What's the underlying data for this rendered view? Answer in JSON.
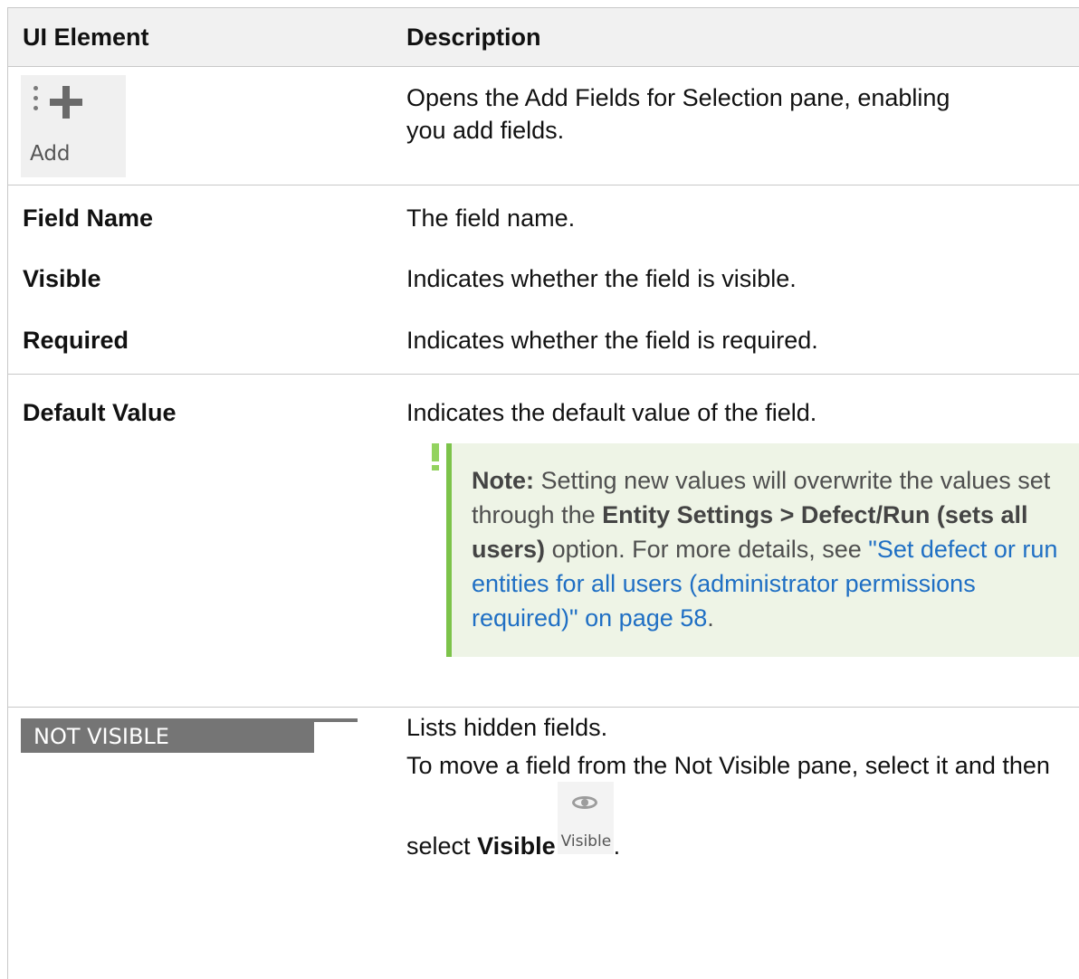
{
  "table": {
    "headers": {
      "col1": "UI Element",
      "col2": "Description"
    },
    "add_row": {
      "icon_label": "Add",
      "description": "Opens the Add Fields for Selection pane, enabling you add fields."
    },
    "field_name_row": {
      "name": "Field Name",
      "description": "The field name."
    },
    "visible_row": {
      "name": "Visible",
      "description": "Indicates whether the field is visible."
    },
    "required_row": {
      "name": "Required",
      "description": "Indicates whether the field is required."
    },
    "default_value_row": {
      "name": "Default Value",
      "description": "Indicates the default value of the field.",
      "note": {
        "label": "Note:",
        "text1": "Setting new values will overwrite the values set through the",
        "bold1": "Entity Settings > Defect/Run (sets all users)",
        "text2": "option. For more details, see",
        "link": "\"Set defect or run entities for all users (administrator permissions required)\" on page 58",
        "end": "."
      }
    },
    "not_visible_row": {
      "bar_label": "NOT VISIBLE",
      "description1": "Lists hidden fields.",
      "description2": "To move a field from the Not Visible pane, select it and then select",
      "bold": "Visible",
      "icon_label": "Visible",
      "end": "."
    }
  }
}
